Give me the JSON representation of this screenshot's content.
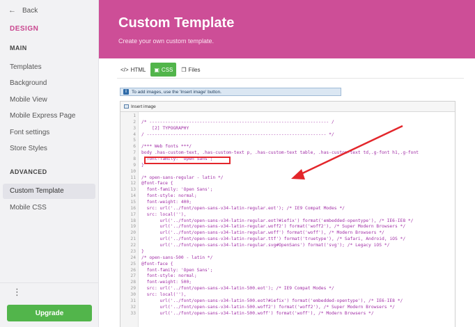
{
  "sidebar": {
    "back_label": "Back",
    "design_title": "DESIGN",
    "main_label": "MAIN",
    "main_items": [
      "Templates",
      "Background",
      "Mobile View",
      "Mobile Express Page",
      "Font settings",
      "Store Styles"
    ],
    "advanced_label": "ADVANCED",
    "advanced_items": [
      "Custom Template",
      "Mobile CSS"
    ],
    "more_label": "⋮",
    "upgrade_label": "Upgrade"
  },
  "header": {
    "title": "Custom Template",
    "subtitle": "Create your own custom template."
  },
  "tabs": [
    {
      "label": "HTML",
      "icon": "code-icon",
      "glyph": "</>"
    },
    {
      "label": "CSS",
      "icon": "paint-roller-icon",
      "glyph": "▣"
    },
    {
      "label": "Files",
      "icon": "files-icon",
      "glyph": "❐"
    }
  ],
  "active_tab": "CSS",
  "info": {
    "icon_text": "i",
    "text": "To add images, use the 'Insert image' button."
  },
  "editor": {
    "insert_image_label": "Insert image",
    "lines": [
      {
        "n": "1",
        "t": ""
      },
      {
        "n": "2",
        "t": "/* -------------------------------------------------------------------- /"
      },
      {
        "n": "3",
        "t": "    [2] TYPOGRAPHY"
      },
      {
        "n": "4",
        "t": "/ -------------------------------------------------------------------- */"
      },
      {
        "n": "5",
        "t": ""
      },
      {
        "n": "6",
        "t": "/*** Web fonts ***/"
      },
      {
        "n": "7",
        "t": "body .has-custom-text, .has-custom-text p, .has-custom-text table, .has-custom-text td,.g-font h1,.g-font"
      },
      {
        "n": "8",
        "t": "  font-family: 'Open Sans';"
      },
      {
        "n": "9",
        "t": "}"
      },
      {
        "n": "10",
        "t": ""
      },
      {
        "n": "11",
        "t": "/* open-sans-regular - latin */"
      },
      {
        "n": "12",
        "t": "@font-face {"
      },
      {
        "n": "13",
        "t": "  font-family: 'Open Sans';"
      },
      {
        "n": "14",
        "t": "  font-style: normal;"
      },
      {
        "n": "15",
        "t": "  font-weight: 400;"
      },
      {
        "n": "16",
        "t": "  src: url('../font/open-sans-v34-latin-regular.eot'); /* IE9 Compat Modes */"
      },
      {
        "n": "17",
        "t": "  src: local(''),"
      },
      {
        "n": "18",
        "t": "       url('../font/open-sans-v34-latin-regular.eot?#iefix') format('embedded-opentype'), /* IE6-IE8 */"
      },
      {
        "n": "19",
        "t": "       url('../font/open-sans-v34-latin-regular.woff2') format('woff2'), /* Super Modern Browsers */"
      },
      {
        "n": "20",
        "t": "       url('../font/open-sans-v34-latin-regular.woff') format('woff'), /* Modern Browsers */"
      },
      {
        "n": "21",
        "t": "       url('../font/open-sans-v34-latin-regular.ttf') format('truetype'), /* Safari, Android, iOS */"
      },
      {
        "n": "22",
        "t": "       url('../font/open-sans-v34-latin-regular.svg#OpenSans') format('svg'); /* Legacy iOS */"
      },
      {
        "n": "23",
        "t": "}"
      },
      {
        "n": "24",
        "t": "/* open-sans-500 - latin */"
      },
      {
        "n": "25",
        "t": "@font-face {"
      },
      {
        "n": "26",
        "t": "  font-family: 'Open Sans';"
      },
      {
        "n": "27",
        "t": "  font-style: normal;"
      },
      {
        "n": "28",
        "t": "  font-weight: 500;"
      },
      {
        "n": "29",
        "t": "  src: url('../font/open-sans-v34-latin-500.eot'); /* IE9 Compat Modes */"
      },
      {
        "n": "30",
        "t": "  src: local(''),"
      },
      {
        "n": "31",
        "t": "       url('../font/open-sans-v34-latin-500.eot?#iefix') format('embedded-opentype'), /* IE6-IE8 */"
      },
      {
        "n": "32",
        "t": "       url('../font/open-sans-v34-latin-500.woff2') format('woff2'), /* Super Modern Browsers */"
      },
      {
        "n": "33",
        "t": "       url('../font/open-sans-v34-latin-500.woff') format('woff'), /* Modern Browsers */"
      }
    ]
  },
  "colors": {
    "brand_pink": "#cd4e97",
    "upgrade_green": "#52b54b",
    "annotation_red": "#e3262b",
    "code_purple": "#a12ea6"
  }
}
